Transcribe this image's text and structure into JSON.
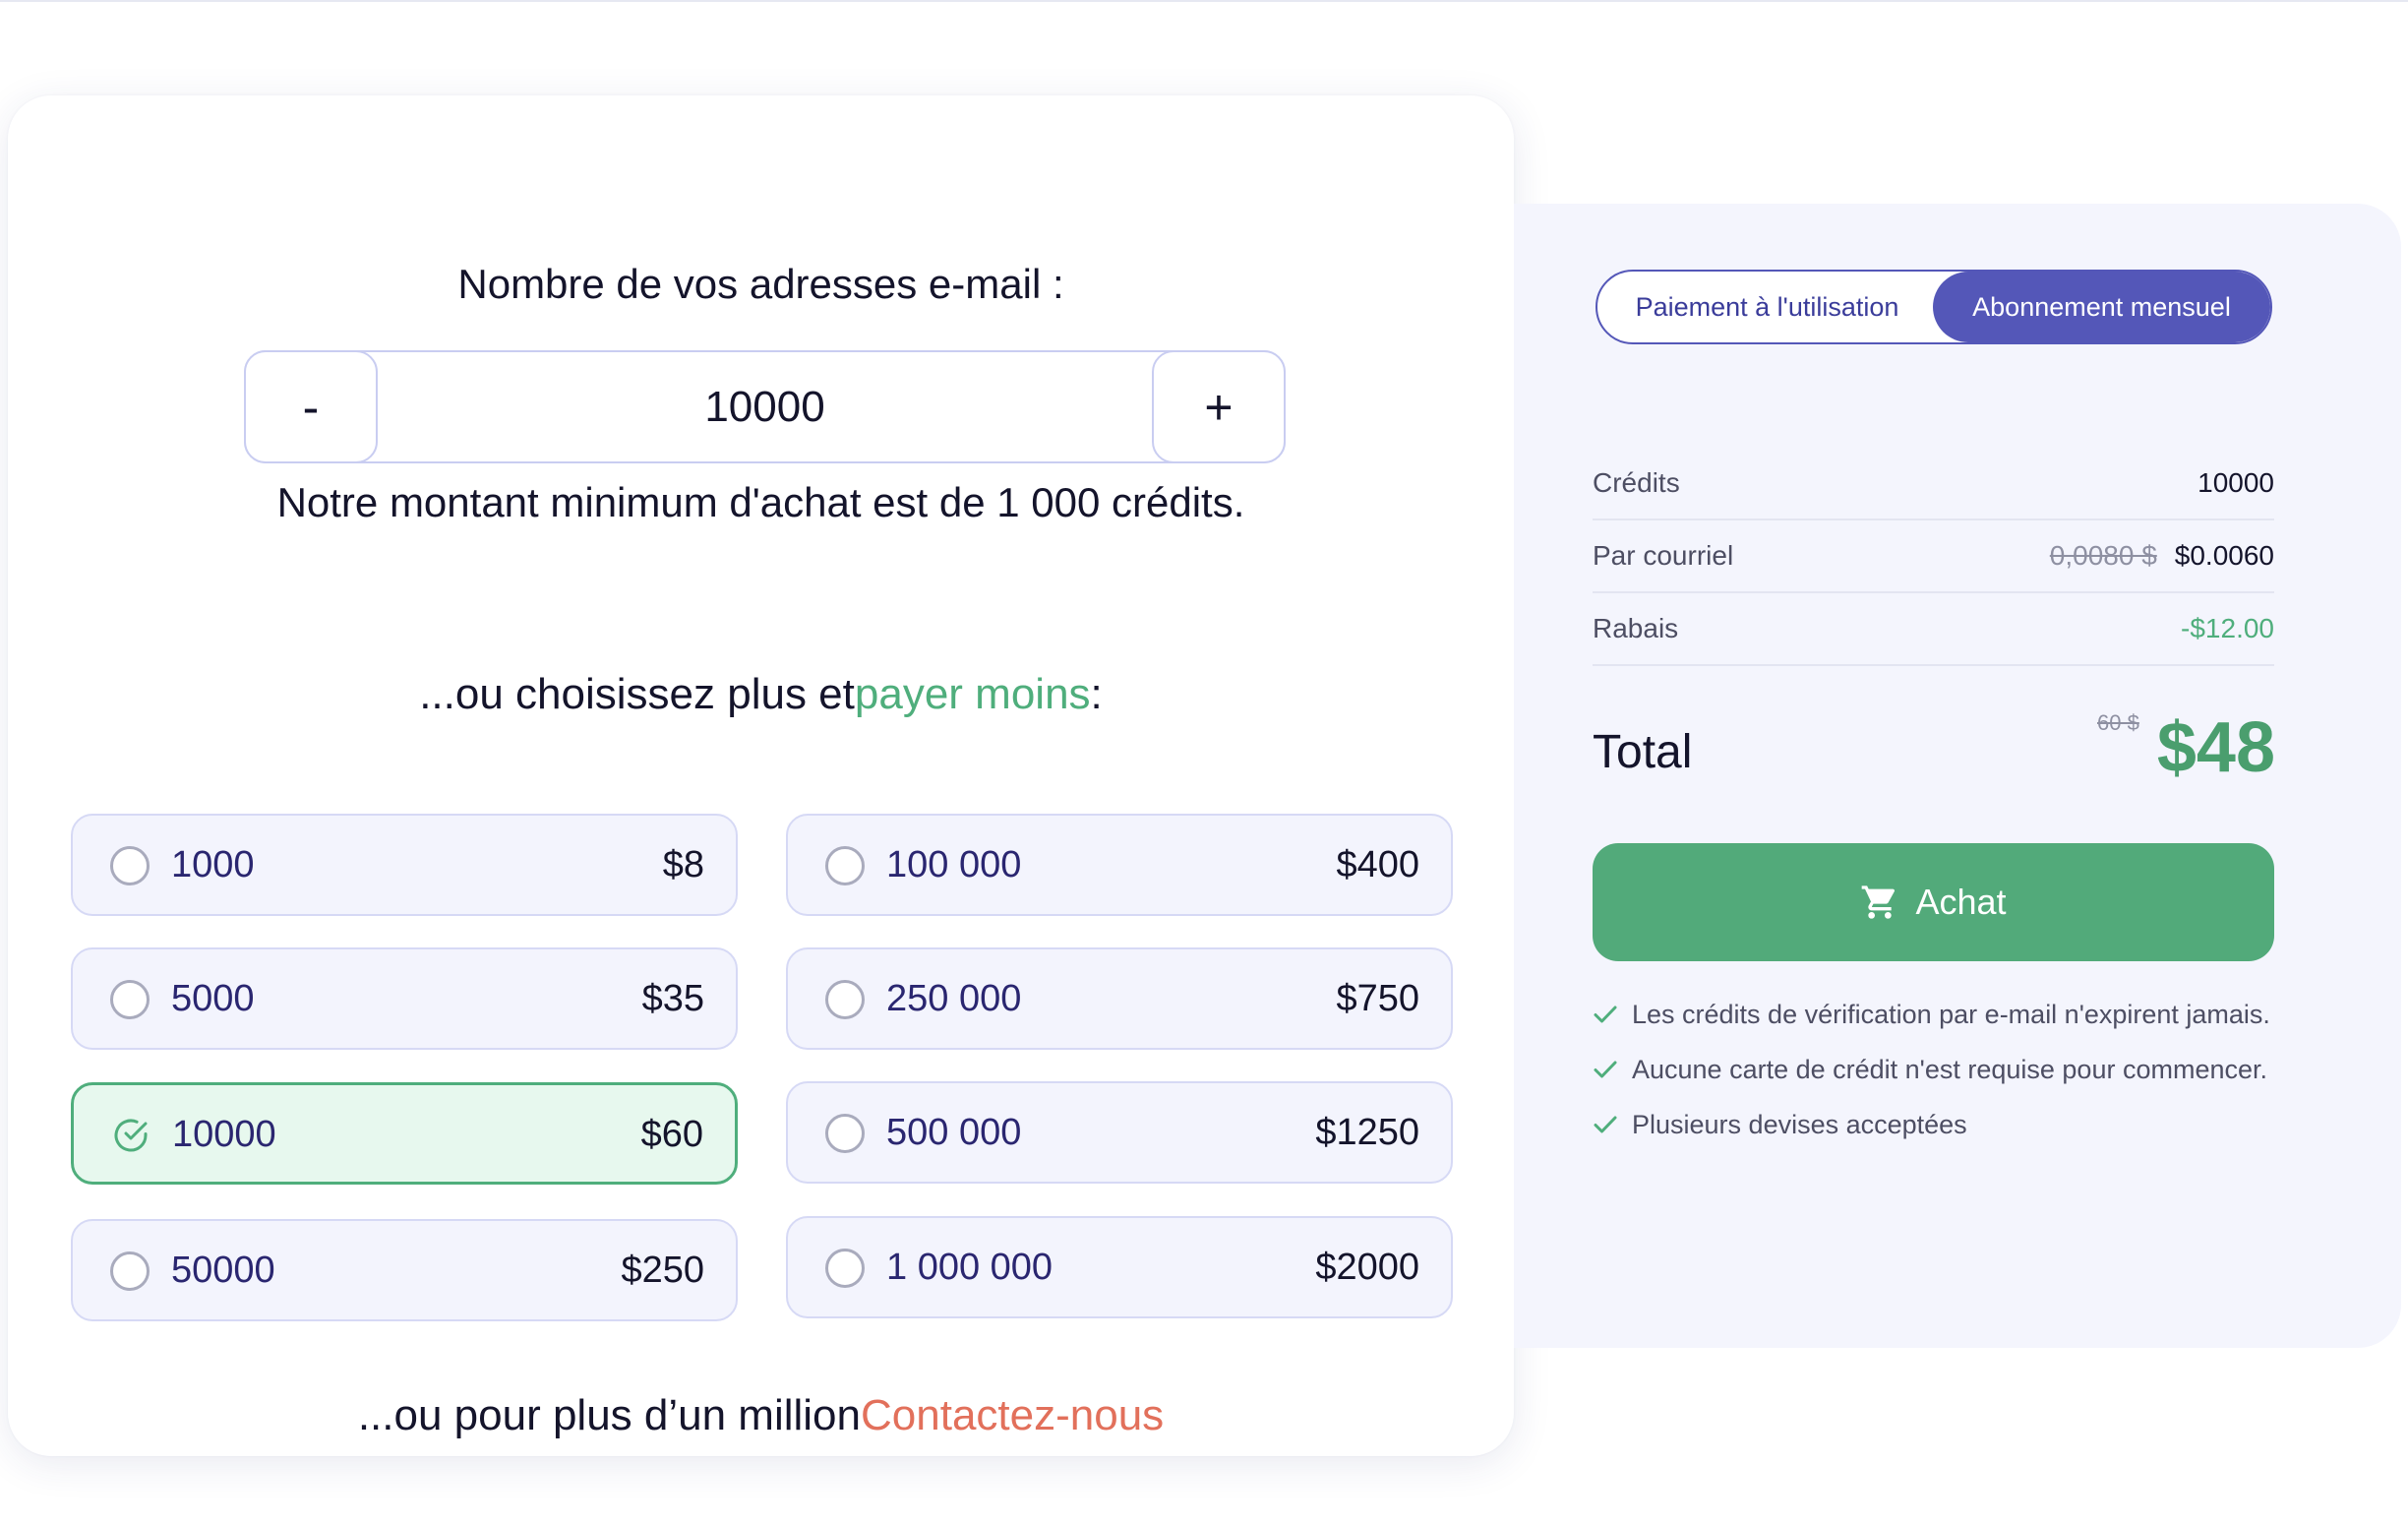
{
  "quantity": {
    "title": "Nombre de vos adresses e-mail :",
    "minus_label": "-",
    "plus_label": "+",
    "value": "10000",
    "min_note": "Notre montant minimum d'achat est de 1 000 crédits."
  },
  "choose": {
    "prefix": "...ou choisissez plus et",
    "highlight": "payer moins",
    "suffix": ":"
  },
  "options": [
    {
      "qty": "1000",
      "price": "$8",
      "selected": false
    },
    {
      "qty": "100 000",
      "price": "$400",
      "selected": false
    },
    {
      "qty": "5000",
      "price": "$35",
      "selected": false
    },
    {
      "qty": "250 000",
      "price": "$750",
      "selected": false
    },
    {
      "qty": "10000",
      "price": "$60",
      "selected": true
    },
    {
      "qty": "500 000",
      "price": "$1250",
      "selected": false
    },
    {
      "qty": "50000",
      "price": "$250",
      "selected": false
    },
    {
      "qty": "1 000 000",
      "price": "$2000",
      "selected": false
    }
  ],
  "contact": {
    "prefix": "...ou pour plus d’un million",
    "link": "Contactez-nous"
  },
  "summary": {
    "toggle_left": "Paiement à l'utilisation",
    "toggle_right": "Abonnement mensuel",
    "active_toggle": "Abonnement mensuel",
    "credits_label": "Crédits",
    "credits_value": "10000",
    "per_email_label": "Par courriel",
    "per_email_old": "0,0080 $",
    "per_email_value": "$0.0060",
    "discount_label": "Rabais",
    "discount_value": "-$12.00",
    "total_label": "Total",
    "total_old": "60 $",
    "total_value": "$48",
    "buy_label": "Achat",
    "cart_icon": "cart-icon",
    "features": [
      "Les crédits de vérification par e-mail n'expirent jamais.",
      "Aucune carte de crédit n'est requise pour commencer.",
      "Plusieurs devises acceptées"
    ]
  },
  "colors": {
    "brand": "#5457b8",
    "green": "#4fae7c",
    "coral": "#e2705b"
  }
}
